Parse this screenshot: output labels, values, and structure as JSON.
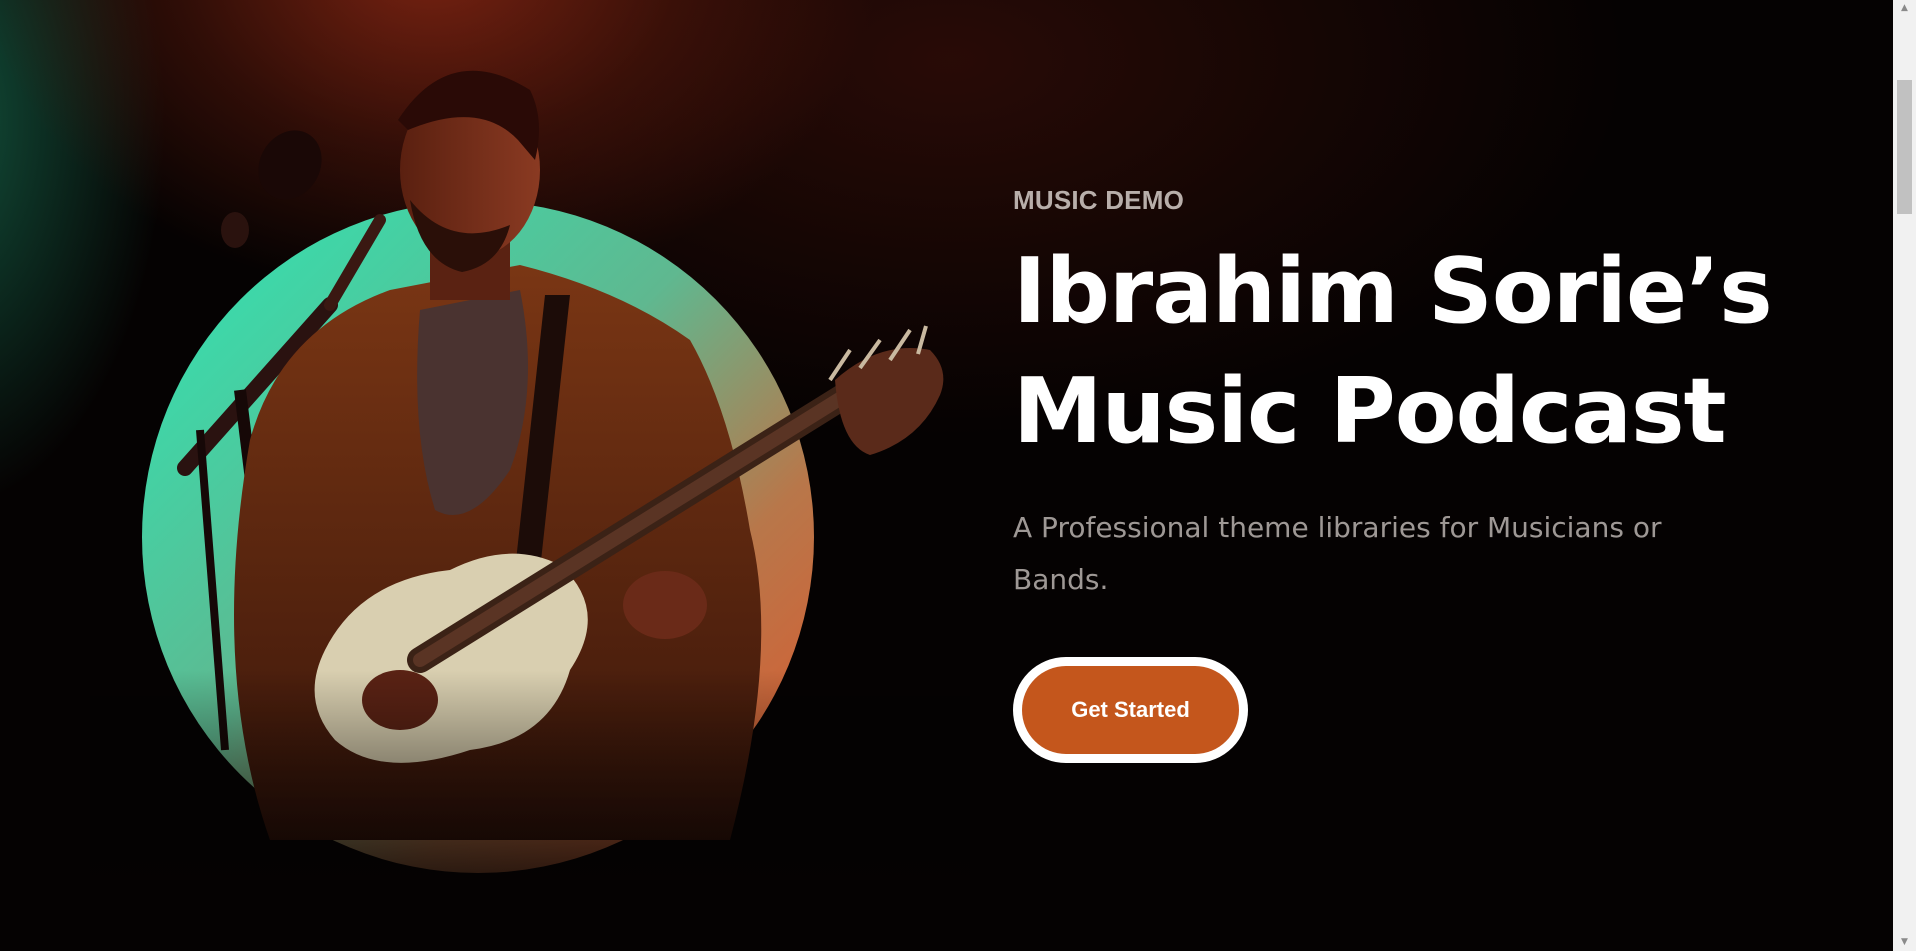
{
  "hero": {
    "eyebrow": "MUSIC DEMO",
    "title_line1": "Ibrahim Sorie’s",
    "title_line2": "Music Podcast",
    "subtitle": "A Professional theme libraries for Musicians or Bands.",
    "cta_label": "Get Started",
    "image_subject": "musician-with-bass-guitar-and-microphone"
  },
  "scrollbar": {
    "up_icon": "▲",
    "down_icon": "▼"
  },
  "colors": {
    "background": "#050202",
    "accent": "#c4561c",
    "circle_start": "#2ee6b4",
    "circle_end": "#e0552a",
    "eyebrow": "#b8aeaa",
    "subtitle": "#9e9895"
  }
}
